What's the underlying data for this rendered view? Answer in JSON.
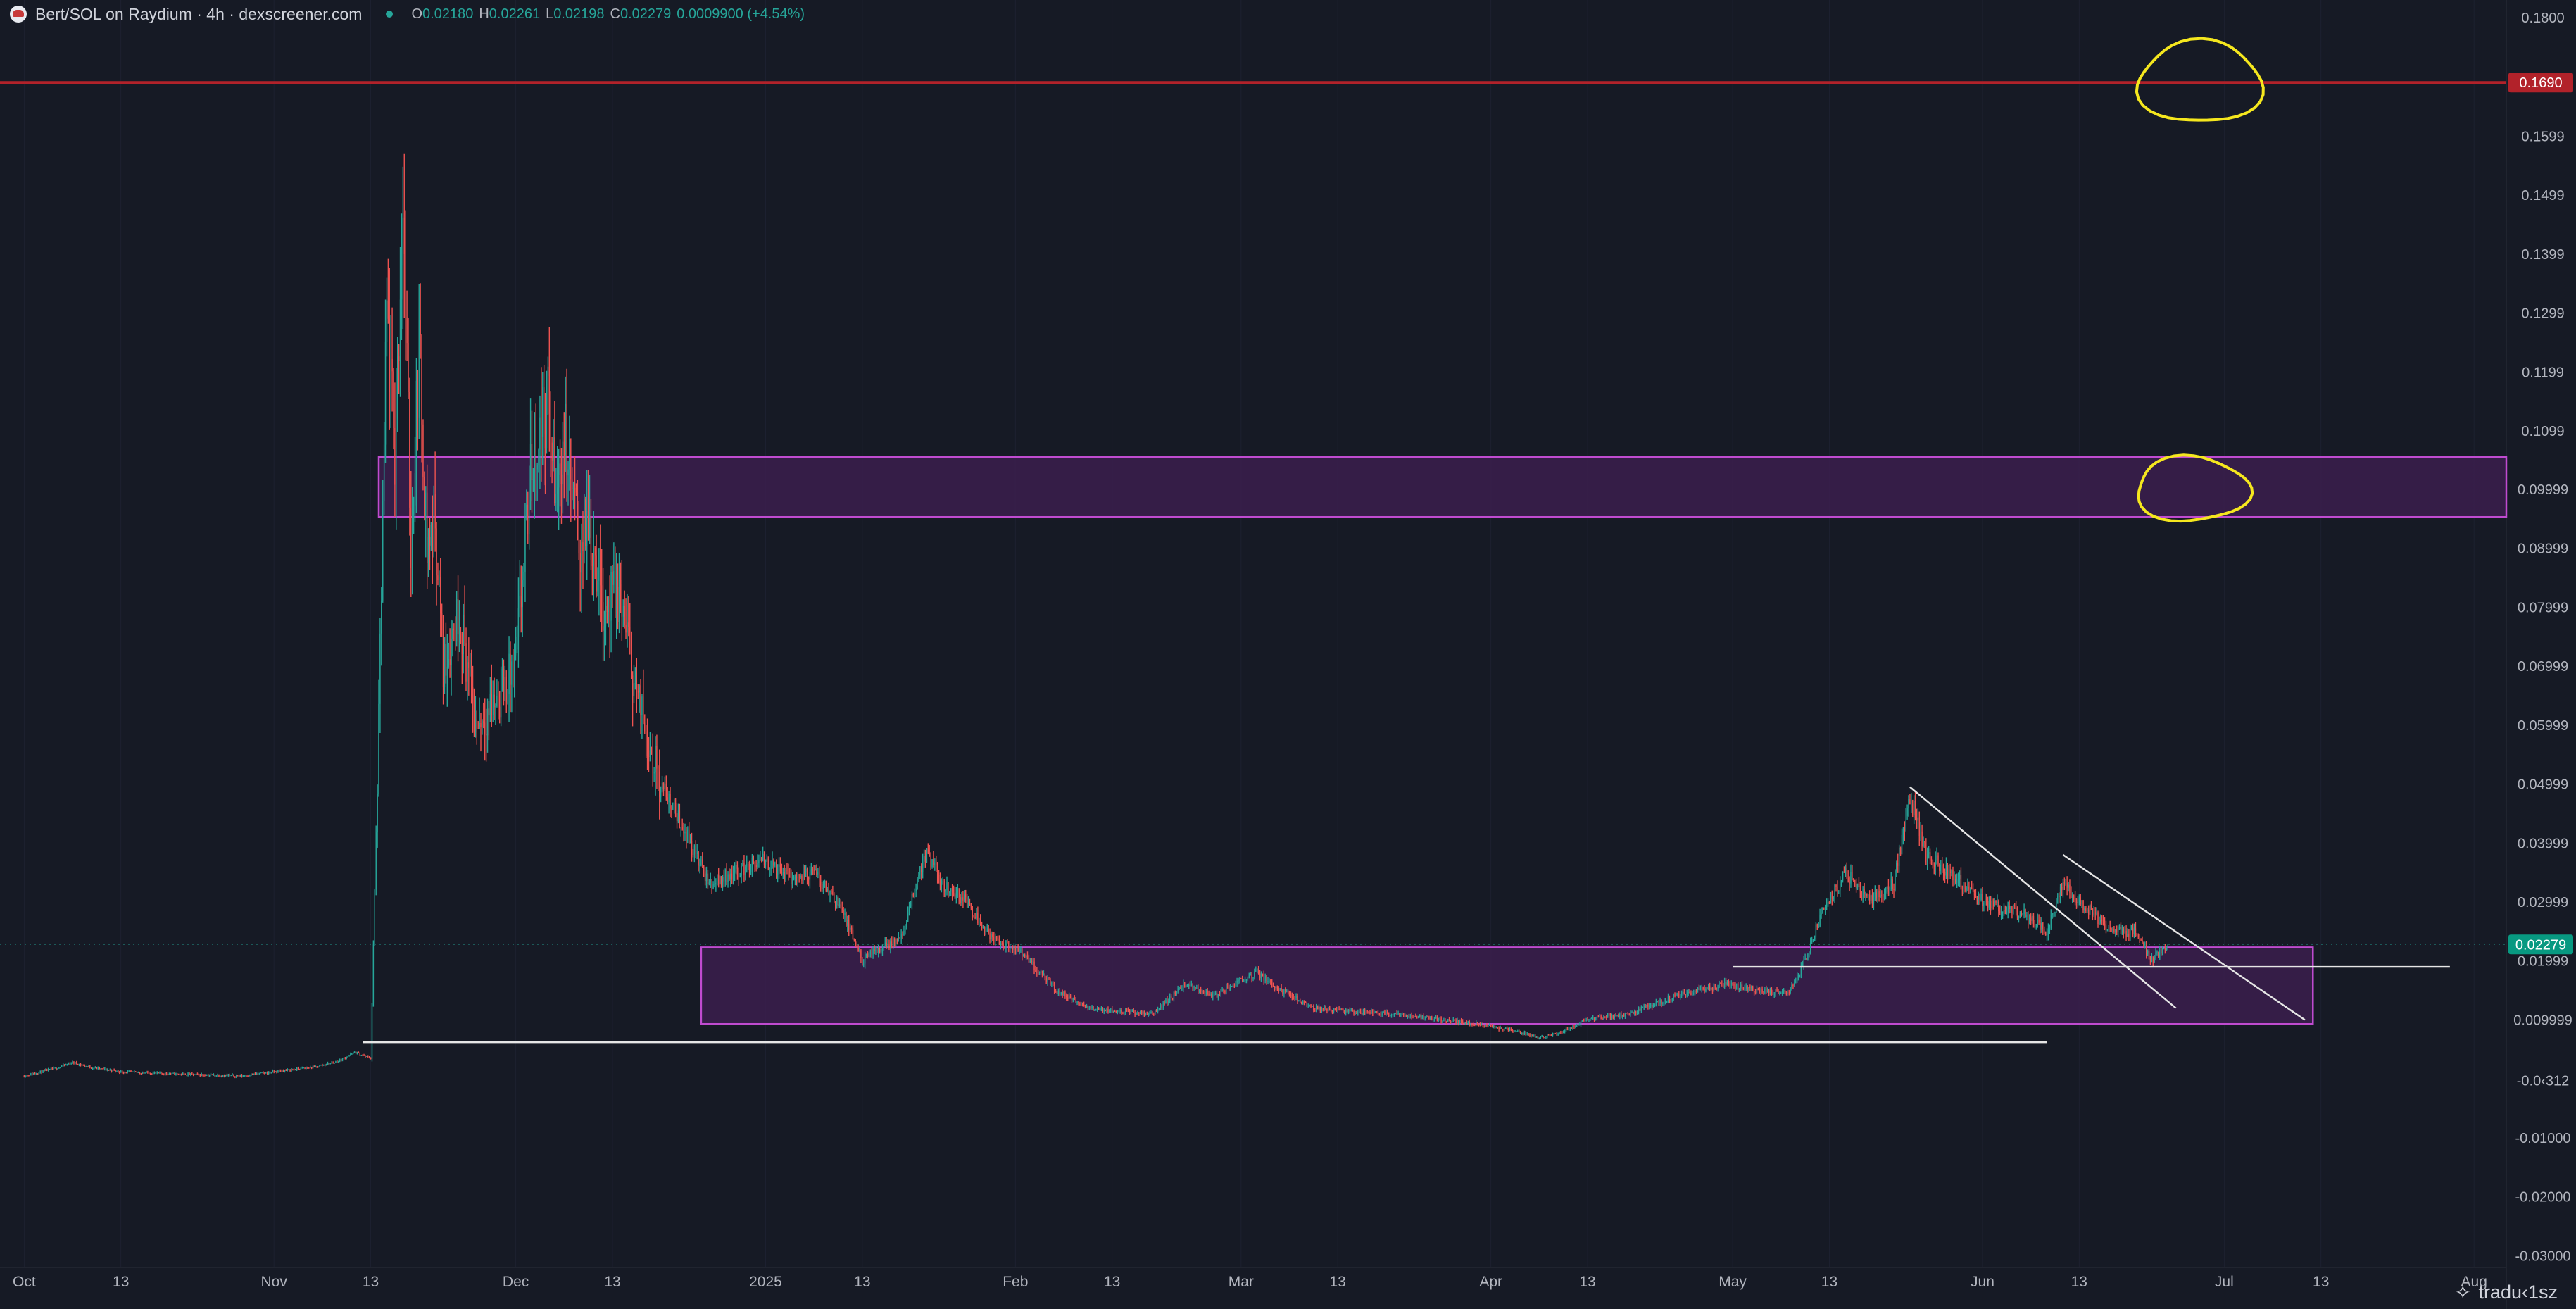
{
  "header": {
    "title": "Bert/SOL on Raydium · 4h · dexscreener.com",
    "open_key": "O",
    "open": "0.02180",
    "high_key": "H",
    "high": "0.02261",
    "low_key": "L",
    "low": "0.02198",
    "close_key": "C",
    "close": "0.02279",
    "change": "0.0009900 (+4.54%)"
  },
  "watermark": "tradu‹1sz",
  "colors": {
    "background": "#161a25",
    "up": "#26a69a",
    "down": "#ef5350",
    "resistance_line": "#b2222a",
    "zone_fill": "#3b1f4d",
    "zone_border": "#c04bd0",
    "trendline": "#e6e6e6",
    "annotation": "#f5e71e",
    "price_badge": "#089981"
  },
  "chart_data": {
    "type": "candlestick",
    "title": "",
    "xlabel": "",
    "ylabel": "",
    "x_range": [
      "2024-09-28",
      "2025-08-05"
    ],
    "ylim": [
      -0.032,
      0.183
    ],
    "y_ticks": [
      "0.1800",
      "0.1690",
      "0.1599",
      "0.1499",
      "0.1399",
      "0.1299",
      "0.1199",
      "0.1099",
      "0.09999",
      "0.08999",
      "0.07999",
      "0.06999",
      "0.05999",
      "0.04999",
      "0.03999",
      "0.02999",
      "0.02279",
      "0.01999",
      "0.009999",
      "-0.0‹312",
      "-0.01000",
      "-0.02000",
      "-0.03000"
    ],
    "y_tick_values": [
      0.18,
      0.169,
      0.1599,
      0.1499,
      0.1399,
      0.1299,
      0.1199,
      0.1099,
      0.09999,
      0.08999,
      0.07999,
      0.06999,
      0.05999,
      0.04999,
      0.03999,
      0.02999,
      0.02279,
      0.01999,
      0.009999,
      -0.0003,
      -0.01,
      -0.02,
      -0.03
    ],
    "x_ticks": [
      {
        "label": "Oct",
        "date": "2024-10-01"
      },
      {
        "label": "13",
        "date": "2024-10-13"
      },
      {
        "label": "Nov",
        "date": "2024-11-01"
      },
      {
        "label": "13",
        "date": "2024-11-13"
      },
      {
        "label": "Dec",
        "date": "2024-12-01"
      },
      {
        "label": "13",
        "date": "2024-12-13"
      },
      {
        "label": "2025",
        "date": "2025-01-01"
      },
      {
        "label": "13",
        "date": "2025-01-13"
      },
      {
        "label": "Feb",
        "date": "2025-02-01"
      },
      {
        "label": "13",
        "date": "2025-02-13"
      },
      {
        "label": "Mar",
        "date": "2025-03-01"
      },
      {
        "label": "13",
        "date": "2025-03-13"
      },
      {
        "label": "Apr",
        "date": "2025-04-01"
      },
      {
        "label": "13",
        "date": "2025-04-13"
      },
      {
        "label": "May",
        "date": "2025-05-01"
      },
      {
        "label": "13",
        "date": "2025-05-13"
      },
      {
        "label": "Jun",
        "date": "2025-06-01"
      },
      {
        "label": "13",
        "date": "2025-06-13"
      },
      {
        "label": "Jul",
        "date": "2025-07-01"
      },
      {
        "label": "13",
        "date": "2025-07-13"
      },
      {
        "label": "Aug",
        "date": "2025-08-01"
      }
    ],
    "price_path": [
      {
        "d": "2024-10-01",
        "p": 0.0005
      },
      {
        "d": "2024-10-05",
        "p": 0.0018
      },
      {
        "d": "2024-10-07",
        "p": 0.0028
      },
      {
        "d": "2024-10-09",
        "p": 0.002
      },
      {
        "d": "2024-10-13",
        "p": 0.0012
      },
      {
        "d": "2024-10-20",
        "p": 0.0008
      },
      {
        "d": "2024-10-28",
        "p": 0.0005
      },
      {
        "d": "2024-11-01",
        "p": 0.0012
      },
      {
        "d": "2024-11-06",
        "p": 0.002
      },
      {
        "d": "2024-11-09",
        "p": 0.003
      },
      {
        "d": "2024-11-11",
        "p": 0.0045
      },
      {
        "d": "2024-11-13",
        "p": 0.0035
      },
      {
        "d": "2024-11-14",
        "p": 0.06
      },
      {
        "d": "2024-11-15",
        "p": 0.13
      },
      {
        "d": "2024-11-16",
        "p": 0.105
      },
      {
        "d": "2024-11-17",
        "p": 0.15
      },
      {
        "d": "2024-11-18",
        "p": 0.09
      },
      {
        "d": "2024-11-19",
        "p": 0.125
      },
      {
        "d": "2024-11-20",
        "p": 0.09
      },
      {
        "d": "2024-11-21",
        "p": 0.095
      },
      {
        "d": "2024-11-22",
        "p": 0.07
      },
      {
        "d": "2024-11-24",
        "p": 0.08
      },
      {
        "d": "2024-11-26",
        "p": 0.06
      },
      {
        "d": "2024-11-29",
        "p": 0.065
      },
      {
        "d": "2024-12-01",
        "p": 0.07
      },
      {
        "d": "2024-12-03",
        "p": 0.105
      },
      {
        "d": "2024-12-05",
        "p": 0.115
      },
      {
        "d": "2024-12-06",
        "p": 0.098
      },
      {
        "d": "2024-12-07",
        "p": 0.11
      },
      {
        "d": "2024-12-09",
        "p": 0.09
      },
      {
        "d": "2024-12-10",
        "p": 0.095
      },
      {
        "d": "2024-12-12",
        "p": 0.08
      },
      {
        "d": "2024-12-14",
        "p": 0.082
      },
      {
        "d": "2024-12-16",
        "p": 0.065
      },
      {
        "d": "2024-12-19",
        "p": 0.05
      },
      {
        "d": "2024-12-22",
        "p": 0.042
      },
      {
        "d": "2024-12-25",
        "p": 0.033
      },
      {
        "d": "2024-12-28",
        "p": 0.035
      },
      {
        "d": "2025-01-01",
        "p": 0.037
      },
      {
        "d": "2025-01-04",
        "p": 0.034
      },
      {
        "d": "2025-01-07",
        "p": 0.035
      },
      {
        "d": "2025-01-10",
        "p": 0.03
      },
      {
        "d": "2025-01-13",
        "p": 0.02
      },
      {
        "d": "2025-01-15",
        "p": 0.022
      },
      {
        "d": "2025-01-18",
        "p": 0.024
      },
      {
        "d": "2025-01-20",
        "p": 0.035
      },
      {
        "d": "2025-01-21",
        "p": 0.038
      },
      {
        "d": "2025-01-23",
        "p": 0.033
      },
      {
        "d": "2025-01-26",
        "p": 0.03
      },
      {
        "d": "2025-01-29",
        "p": 0.024
      },
      {
        "d": "2025-02-02",
        "p": 0.021
      },
      {
        "d": "2025-02-06",
        "p": 0.015
      },
      {
        "d": "2025-02-10",
        "p": 0.012
      },
      {
        "d": "2025-02-14",
        "p": 0.0115
      },
      {
        "d": "2025-02-18",
        "p": 0.011
      },
      {
        "d": "2025-02-22",
        "p": 0.016
      },
      {
        "d": "2025-02-26",
        "p": 0.014
      },
      {
        "d": "2025-03-01",
        "p": 0.017
      },
      {
        "d": "2025-03-03",
        "p": 0.018
      },
      {
        "d": "2025-03-06",
        "p": 0.015
      },
      {
        "d": "2025-03-10",
        "p": 0.012
      },
      {
        "d": "2025-03-14",
        "p": 0.0115
      },
      {
        "d": "2025-03-20",
        "p": 0.011
      },
      {
        "d": "2025-03-26",
        "p": 0.01
      },
      {
        "d": "2025-04-01",
        "p": 0.009
      },
      {
        "d": "2025-04-07",
        "p": 0.007
      },
      {
        "d": "2025-04-10",
        "p": 0.008
      },
      {
        "d": "2025-04-13",
        "p": 0.01
      },
      {
        "d": "2025-04-18",
        "p": 0.011
      },
      {
        "d": "2025-04-24",
        "p": 0.014
      },
      {
        "d": "2025-04-30",
        "p": 0.016
      },
      {
        "d": "2025-05-04",
        "p": 0.015
      },
      {
        "d": "2025-05-08",
        "p": 0.0145
      },
      {
        "d": "2025-05-10",
        "p": 0.02
      },
      {
        "d": "2025-05-12",
        "p": 0.028
      },
      {
        "d": "2025-05-15",
        "p": 0.035
      },
      {
        "d": "2025-05-18",
        "p": 0.03
      },
      {
        "d": "2025-05-21",
        "p": 0.033
      },
      {
        "d": "2025-05-23",
        "p": 0.048
      },
      {
        "d": "2025-05-25",
        "p": 0.038
      },
      {
        "d": "2025-05-28",
        "p": 0.035
      },
      {
        "d": "2025-05-31",
        "p": 0.031
      },
      {
        "d": "2025-06-03",
        "p": 0.029
      },
      {
        "d": "2025-06-06",
        "p": 0.028
      },
      {
        "d": "2025-06-09",
        "p": 0.025
      },
      {
        "d": "2025-06-11",
        "p": 0.033
      },
      {
        "d": "2025-06-14",
        "p": 0.029
      },
      {
        "d": "2025-06-17",
        "p": 0.025
      },
      {
        "d": "2025-06-20",
        "p": 0.025
      },
      {
        "d": "2025-06-22",
        "p": 0.02
      },
      {
        "d": "2025-06-24",
        "p": 0.0228
      }
    ],
    "horizontal_lines": [
      {
        "price": 0.169,
        "label": "0.1690",
        "role": "resistance"
      },
      {
        "price": 0.0228,
        "label": "0.02279",
        "role": "current-price"
      }
    ],
    "zones": [
      {
        "from": "2024-11-14",
        "to": "2025-08-05",
        "low": 0.0953,
        "high": 0.1055
      },
      {
        "from": "2024-12-24",
        "to": "2025-07-12",
        "low": 0.0093,
        "high": 0.0223
      }
    ],
    "segments": [
      {
        "x1": "2024-11-12",
        "y1": 0.0062,
        "x2": "2025-06-09",
        "y2": 0.0062
      },
      {
        "x1": "2025-05-01",
        "y1": 0.019,
        "x2": "2025-07-29",
        "y2": 0.019
      },
      {
        "x1": "2025-05-23",
        "y1": 0.0495,
        "x2": "2025-06-25",
        "y2": 0.012
      },
      {
        "x1": "2025-06-11",
        "y1": 0.038,
        "x2": "2025-07-11",
        "y2": 0.01
      }
    ],
    "annotations": [
      {
        "type": "freehand-circle",
        "date": "2025-06-28",
        "price": 0.169
      },
      {
        "type": "freehand-circle",
        "date": "2025-06-27",
        "price": 0.1
      }
    ]
  }
}
